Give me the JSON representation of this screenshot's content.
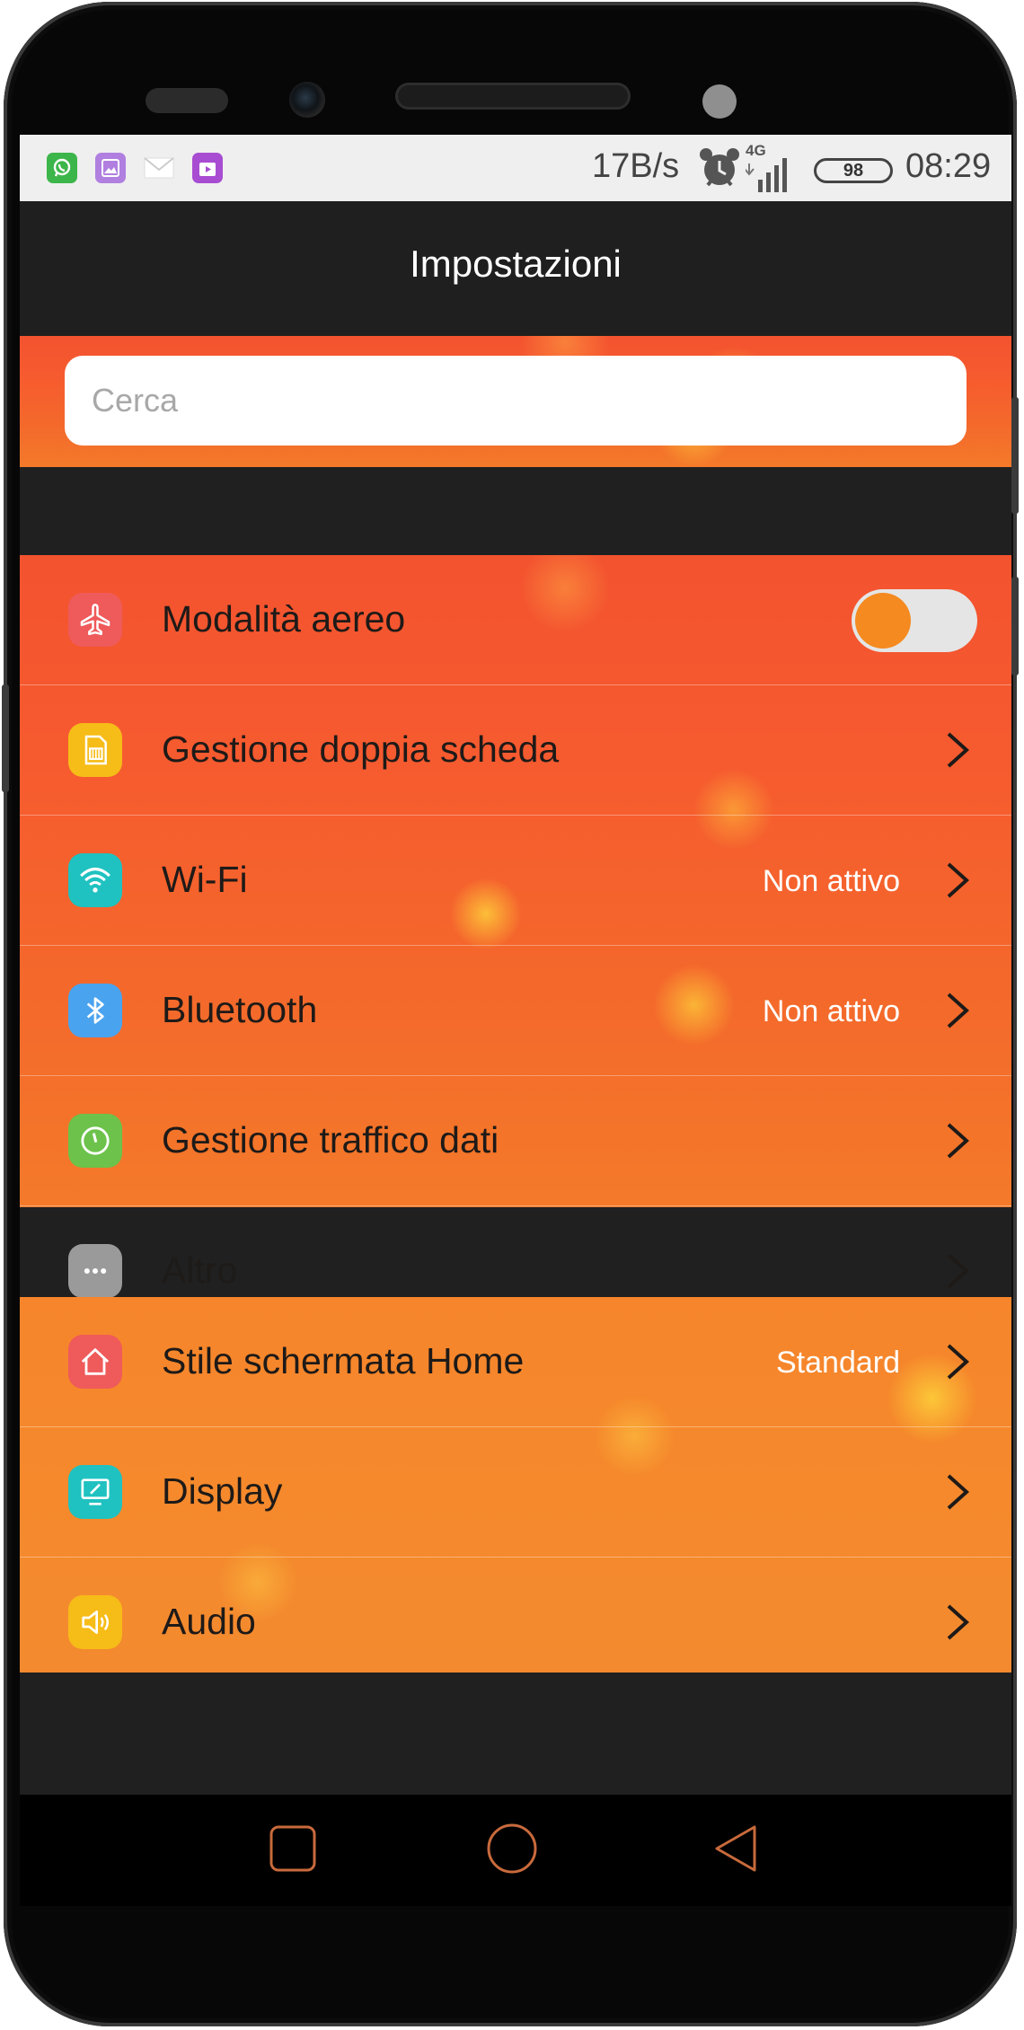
{
  "status_bar": {
    "notification_icons": [
      "whatsapp-icon",
      "gallery-icon",
      "mail-icon",
      "store-icon"
    ],
    "net_speed": "17B/s",
    "network_type": "4G",
    "battery": "98",
    "time": "08:29"
  },
  "header": {
    "title": "Impostazioni"
  },
  "search": {
    "placeholder": "Cerca"
  },
  "groups": [
    {
      "items": [
        {
          "label": "Modalità aereo",
          "icon": "airplane-icon",
          "icon_color": "#ef5a5a",
          "control": "toggle",
          "toggle_on": false
        },
        {
          "label": "Gestione doppia scheda",
          "icon": "sim-card-icon",
          "icon_color": "#f6bc18",
          "control": "chevron"
        },
        {
          "label": "Wi-Fi",
          "value": "Non attivo",
          "icon": "wifi-icon",
          "icon_color": "#1fc2c0",
          "control": "chevron"
        },
        {
          "label": "Bluetooth",
          "value": "Non attivo",
          "icon": "bluetooth-icon",
          "icon_color": "#4aa3ef",
          "control": "chevron"
        },
        {
          "label": "Gestione traffico dati",
          "icon": "data-usage-icon",
          "icon_color": "#6cc24a",
          "control": "chevron"
        },
        {
          "label": "Altro",
          "icon": "more-icon",
          "icon_color": "#9a9a9a",
          "control": "chevron"
        }
      ]
    },
    {
      "items": [
        {
          "label": "Stile schermata Home",
          "value": "Standard",
          "icon": "home-icon",
          "icon_color": "#ef5a5a",
          "control": "chevron"
        },
        {
          "label": "Display",
          "icon": "display-icon",
          "icon_color": "#1fc2c0",
          "control": "chevron"
        },
        {
          "label": "Audio",
          "icon": "speaker-icon",
          "icon_color": "#f6bc18",
          "control": "chevron"
        }
      ]
    }
  ],
  "nav_bar": {
    "buttons": [
      "recents-button",
      "home-button",
      "back-button"
    ],
    "accent": "#c86a3c"
  }
}
